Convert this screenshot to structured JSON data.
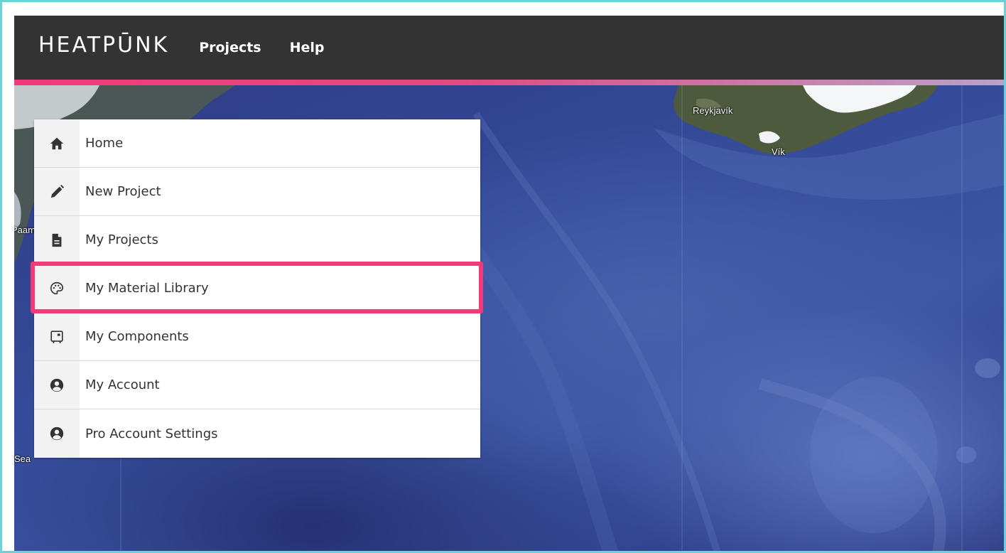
{
  "brand": {
    "logo_text": "HEATPŪNK",
    "accent_color": "#f23a78",
    "navbar_color": "#333333"
  },
  "nav": {
    "links": [
      {
        "label": "Projects"
      },
      {
        "label": "Help"
      }
    ]
  },
  "menu": {
    "items": [
      {
        "label": "Home",
        "icon": "home-icon"
      },
      {
        "label": "New Project",
        "icon": "pencil-icon"
      },
      {
        "label": "My Projects",
        "icon": "file-icon"
      },
      {
        "label": "My Material Library",
        "icon": "palette-icon",
        "highlighted": true
      },
      {
        "label": "My Components",
        "icon": "component-icon"
      },
      {
        "label": "My Account",
        "icon": "user-circle-icon"
      },
      {
        "label": "Pro Account Settings",
        "icon": "user-circle-icon"
      }
    ]
  },
  "map": {
    "labels": {
      "reykjavik": "Reykjavík",
      "vik": "Vík",
      "paam": "Paam",
      "sea": "Sea"
    }
  }
}
